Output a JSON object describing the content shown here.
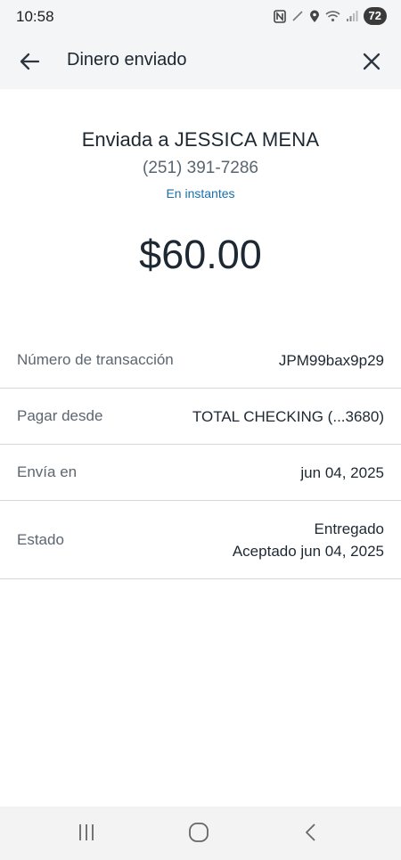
{
  "status_bar": {
    "time": "10:58",
    "battery": "72",
    "icons": [
      "nfc-icon",
      "signal-off-icon",
      "location-icon",
      "wifi-icon",
      "cell-signal-icon",
      "battery-icon"
    ]
  },
  "app_bar": {
    "title": "Dinero enviado",
    "back_icon": "arrow-left-icon",
    "close_icon": "close-icon"
  },
  "summary": {
    "sent_to_prefix": "Enviada a",
    "recipient_name": "JESSICA MENA",
    "phone": "(251) 391-7286",
    "speed": "En instantes",
    "amount": "$60.00"
  },
  "details": {
    "rows": [
      {
        "label": "Número de transacción",
        "value": "JPM99bax9p29"
      },
      {
        "label": "Pagar desde",
        "value": "TOTAL CHECKING (...3680)"
      },
      {
        "label": "Envía en",
        "value": "jun 04, 2025"
      },
      {
        "label": "Estado",
        "value": "Entregado",
        "value_secondary": "Aceptado jun 04, 2025"
      }
    ]
  },
  "nav_bar": {
    "icons": [
      "recents-icon",
      "home-icon",
      "back-icon"
    ]
  },
  "colors": {
    "header_bg": "#f3f5f7",
    "text_primary": "#1d2833",
    "text_secondary": "#5c6670",
    "link_blue": "#1a6fa8",
    "divider": "#d4d8dc"
  }
}
